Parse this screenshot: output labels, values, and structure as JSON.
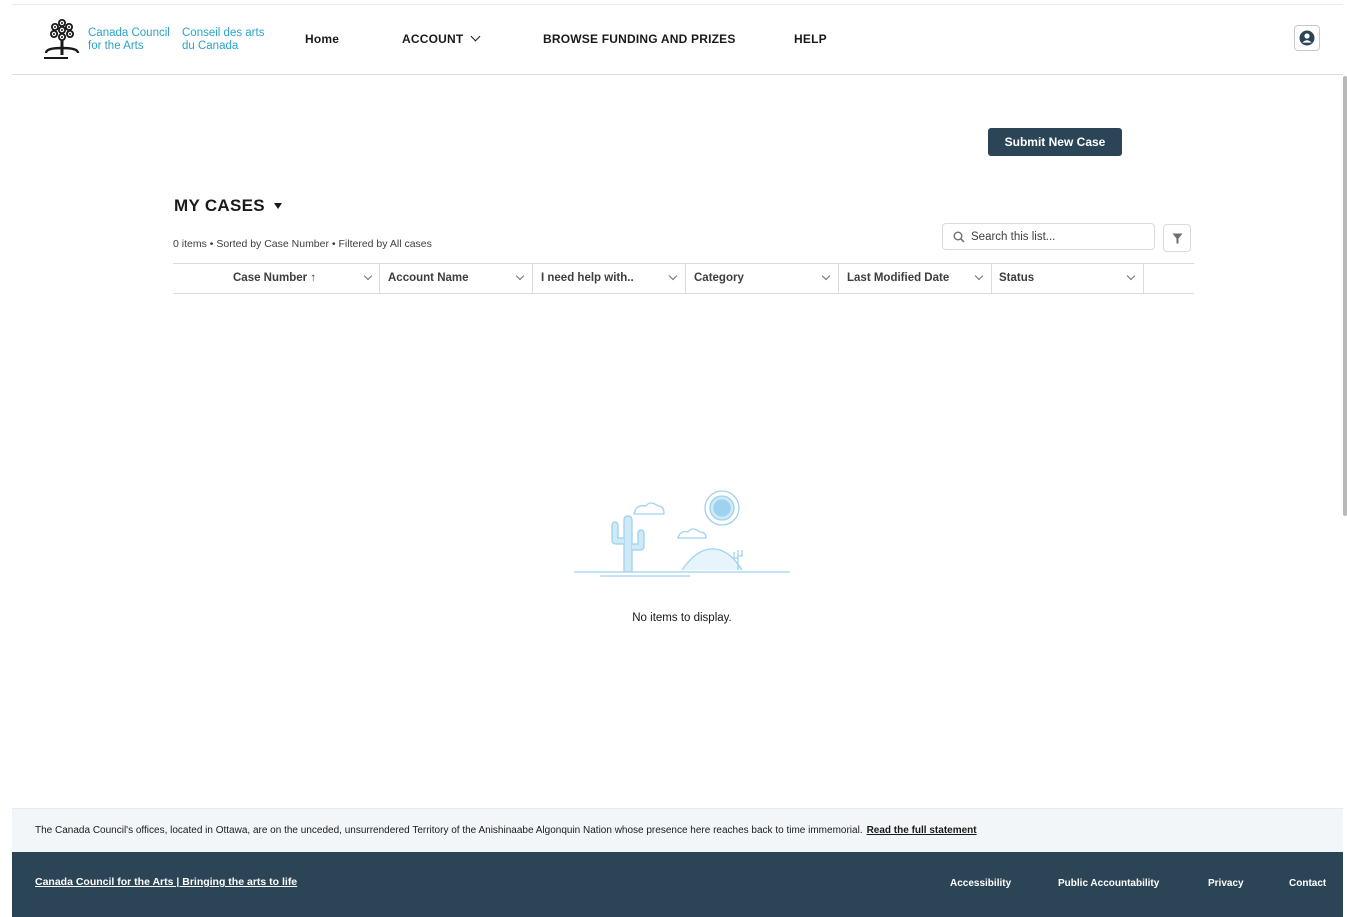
{
  "brand": {
    "name_en_line1": "Canada Council",
    "name_en_line2": "for the Arts",
    "name_fr_line1": "Conseil des arts",
    "name_fr_line2": "du Canada"
  },
  "nav": {
    "home": "Home",
    "account": "ACCOUNT",
    "browse": "BROWSE FUNDING AND PRIZES",
    "help": "HELP"
  },
  "actions": {
    "submit_new_case": "Submit New Case"
  },
  "list": {
    "title": "MY CASES",
    "meta": "0 items • Sorted by Case Number • Filtered by All cases",
    "search_placeholder": "Search this list...",
    "columns": [
      {
        "label": "Case Number ↑"
      },
      {
        "label": "Account Name"
      },
      {
        "label": "I need help with.."
      },
      {
        "label": "Category"
      },
      {
        "label": "Last Modified Date"
      },
      {
        "label": "Status"
      }
    ],
    "empty_message": "No items to display."
  },
  "footer": {
    "land_acknowledgement": "The Canada Council's offices, located in Ottawa, are on the unceded, unsurrendered Territory of the Anishinaabe Algonquin Nation whose presence here reaches back to time immemorial.",
    "land_ack_link": "Read the full statement",
    "brand_link": "Canada Council for the Arts | Bringing the arts to life",
    "links": [
      "Accessibility",
      "Public Accountability",
      "Privacy",
      "Contact"
    ]
  },
  "colors": {
    "brand_blue": "#2ba3c9",
    "dark_navy": "#2c4556",
    "illustration_blue": "#9ed2ee"
  }
}
